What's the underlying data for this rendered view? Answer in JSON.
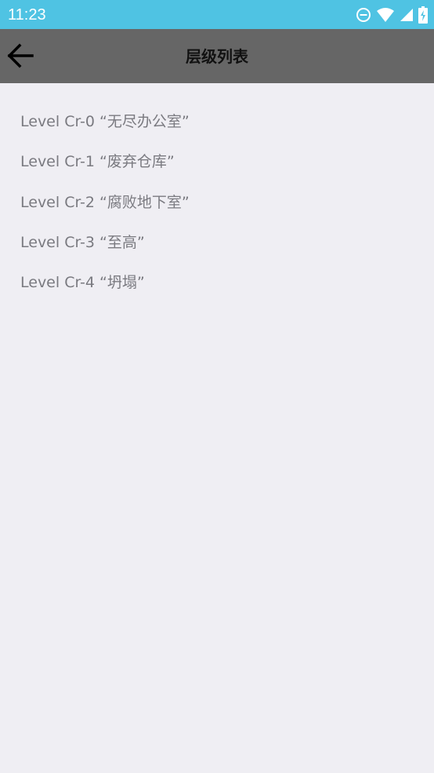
{
  "status_bar": {
    "time": "11:23",
    "icons": [
      "do-not-disturb-icon",
      "wifi-icon",
      "signal-icon",
      "battery-charging-icon"
    ]
  },
  "toolbar": {
    "back_icon": "arrow-left-icon",
    "title": "层级列表"
  },
  "levels": [
    {
      "label": "Level Cr-0 “无尽办公室”"
    },
    {
      "label": "Level Cr-1 “废弃仓库”"
    },
    {
      "label": "Level Cr-2 “腐败地下室”"
    },
    {
      "label": "Level Cr-3 “至高”"
    },
    {
      "label": "Level Cr-4 “坍塌”"
    }
  ],
  "colors": {
    "status_bar": "#4fc3e3",
    "toolbar": "#666666",
    "background": "#efeef3",
    "list_text": "#7a7a80"
  }
}
